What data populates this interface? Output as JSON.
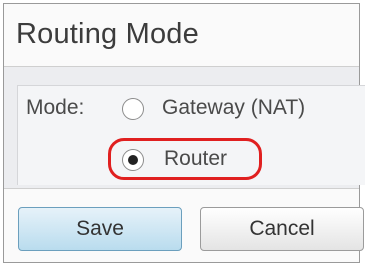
{
  "page": {
    "title": "Routing Mode"
  },
  "form": {
    "mode_label": "Mode:",
    "options": [
      {
        "label": "Gateway (NAT)",
        "selected": false
      },
      {
        "label": "Router",
        "selected": true
      }
    ]
  },
  "buttons": {
    "save_label": "Save",
    "cancel_label": "Cancel"
  },
  "colors": {
    "highlight": "#e02020",
    "save_button": "#b9dcee"
  }
}
